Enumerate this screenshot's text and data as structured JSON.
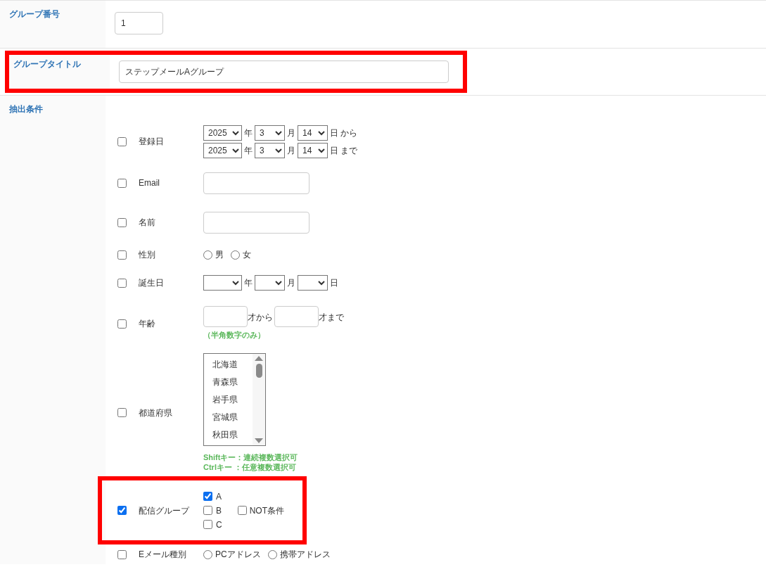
{
  "fields": [
    {
      "label": "グループ番号",
      "kind": "short",
      "value": "1",
      "highlighted": false
    },
    {
      "label": "グループタイトル",
      "kind": "long",
      "value": "ステップメールAグループ",
      "highlighted": true
    }
  ],
  "criteria": {
    "label": "抽出条件",
    "items": [
      {
        "kind": "date_range",
        "label": "登録日",
        "checked": false,
        "highlighted": false,
        "rows": [
          {
            "year": "2025",
            "year_unit": "年",
            "month": "3",
            "month_unit": "月",
            "day": "14",
            "day_unit": "日 から"
          },
          {
            "year": "2025",
            "year_unit": "年",
            "month": "3",
            "month_unit": "月",
            "day": "14",
            "day_unit": "日 まで"
          }
        ]
      },
      {
        "kind": "text",
        "label": "Email",
        "checked": false,
        "highlighted": false
      },
      {
        "kind": "text",
        "label": "名前",
        "checked": false,
        "highlighted": false
      },
      {
        "kind": "radio",
        "label": "性別",
        "checked": false,
        "highlighted": false,
        "options": [
          {
            "label": "男",
            "selected": false
          },
          {
            "label": "女",
            "selected": false
          }
        ]
      },
      {
        "kind": "date_range",
        "label": "誕生日",
        "checked": false,
        "highlighted": false,
        "rows": [
          {
            "year_unit": "年",
            "month_unit": "月",
            "day_unit": "日"
          }
        ]
      },
      {
        "kind": "age_range",
        "label": "年齢",
        "checked": false,
        "highlighted": false,
        "from_unit": "才から",
        "to_unit": "才まで",
        "note": "（半角数字のみ）"
      },
      {
        "kind": "listbox",
        "label": "都道府県",
        "checked": false,
        "highlighted": false,
        "options": [
          "北海道",
          "青森県",
          "岩手県",
          "宮城県",
          "秋田県"
        ],
        "notes": [
          "Shiftキー：連続複数選択可",
          "Ctrlキー ：任意複数選択可"
        ]
      },
      {
        "kind": "checkbox_group",
        "label": "配信グループ",
        "checked": true,
        "highlighted": true,
        "options": [
          {
            "label": "A",
            "checked": true
          },
          {
            "label": "B",
            "checked": false
          },
          {
            "label": "C",
            "checked": false
          }
        ],
        "extra": {
          "label": "NOT条件",
          "checked": false
        }
      },
      {
        "kind": "radio",
        "label": "Eメール種別",
        "checked": false,
        "highlighted": false,
        "options": [
          {
            "label": "PCアドレス",
            "selected": false
          },
          {
            "label": "携帯アドレス",
            "selected": false
          }
        ]
      }
    ]
  }
}
